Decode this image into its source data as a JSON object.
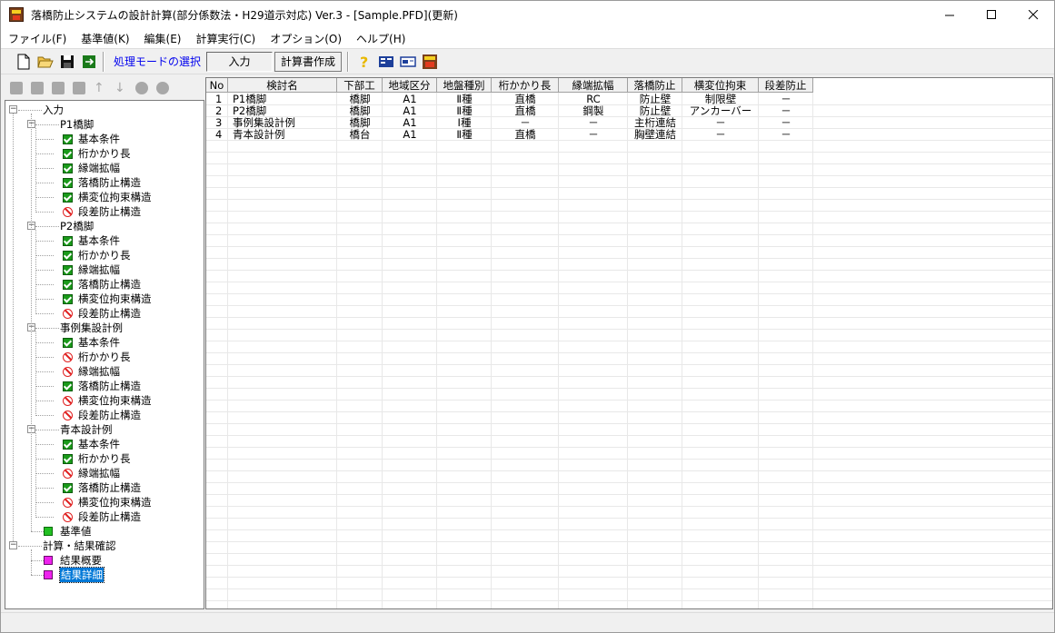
{
  "window": {
    "title": "落橋防止システムの設計計算(部分係数法・H29道示対応) Ver.3 - [Sample.PFD](更新)"
  },
  "menu": [
    "ファイル(F)",
    "基準値(K)",
    "編集(E)",
    "計算実行(C)",
    "オプション(O)",
    "ヘルプ(H)"
  ],
  "toolbar": {
    "mode_label": "処理モードの選択",
    "input_button": "入力",
    "report_button": "計算書作成"
  },
  "tree": {
    "root_input": "入力",
    "groups": [
      {
        "label": "P1橋脚",
        "items": [
          {
            "label": "基本条件",
            "state": "checked"
          },
          {
            "label": "桁かかり長",
            "state": "checked"
          },
          {
            "label": "縁端拡幅",
            "state": "checked"
          },
          {
            "label": "落橋防止構造",
            "state": "checked"
          },
          {
            "label": "横変位拘束構造",
            "state": "checked"
          },
          {
            "label": "段差防止構造",
            "state": "disabled"
          }
        ]
      },
      {
        "label": "P2橋脚",
        "items": [
          {
            "label": "基本条件",
            "state": "checked"
          },
          {
            "label": "桁かかり長",
            "state": "checked"
          },
          {
            "label": "縁端拡幅",
            "state": "checked"
          },
          {
            "label": "落橋防止構造",
            "state": "checked"
          },
          {
            "label": "横変位拘束構造",
            "state": "checked"
          },
          {
            "label": "段差防止構造",
            "state": "disabled"
          }
        ]
      },
      {
        "label": "事例集設計例",
        "items": [
          {
            "label": "基本条件",
            "state": "checked"
          },
          {
            "label": "桁かかり長",
            "state": "disabled"
          },
          {
            "label": "縁端拡幅",
            "state": "disabled"
          },
          {
            "label": "落橋防止構造",
            "state": "checked"
          },
          {
            "label": "横変位拘束構造",
            "state": "disabled"
          },
          {
            "label": "段差防止構造",
            "state": "disabled"
          }
        ]
      },
      {
        "label": "青本設計例",
        "items": [
          {
            "label": "基本条件",
            "state": "checked"
          },
          {
            "label": "桁かかり長",
            "state": "checked"
          },
          {
            "label": "縁端拡幅",
            "state": "disabled"
          },
          {
            "label": "落橋防止構造",
            "state": "checked"
          },
          {
            "label": "横変位拘束構造",
            "state": "disabled"
          },
          {
            "label": "段差防止構造",
            "state": "disabled"
          }
        ]
      }
    ],
    "kijunchi": "基準値",
    "calc_root": "計算・結果確認",
    "result_summary": "結果概要",
    "result_detail": "結果詳細"
  },
  "table": {
    "headers": [
      "No",
      "検討名",
      "下部工",
      "地域区分",
      "地盤種別",
      "桁かかり長",
      "縁端拡幅",
      "落橋防止",
      "横変位拘束",
      "段差防止"
    ],
    "rows": [
      [
        "1",
        "P1橋脚",
        "橋脚",
        "A1",
        "Ⅱ種",
        "直橋",
        "RC",
        "防止壁",
        "制限壁",
        "－"
      ],
      [
        "2",
        "P2橋脚",
        "橋脚",
        "A1",
        "Ⅱ種",
        "直橋",
        "鋼製",
        "防止壁",
        "アンカーバー",
        "－"
      ],
      [
        "3",
        "事例集設計例",
        "橋脚",
        "A1",
        "Ⅰ種",
        "－",
        "－",
        "主桁連結",
        "－",
        "－"
      ],
      [
        "4",
        "青本設計例",
        "橋台",
        "A1",
        "Ⅱ種",
        "直橋",
        "－",
        "胸壁連結",
        "－",
        "－"
      ]
    ]
  },
  "colors": {
    "check": "#1a9a1a",
    "no": "#e02020",
    "selection": "#0078d7",
    "magenta": "#ee22ee",
    "mode_label": "#0000ee"
  }
}
